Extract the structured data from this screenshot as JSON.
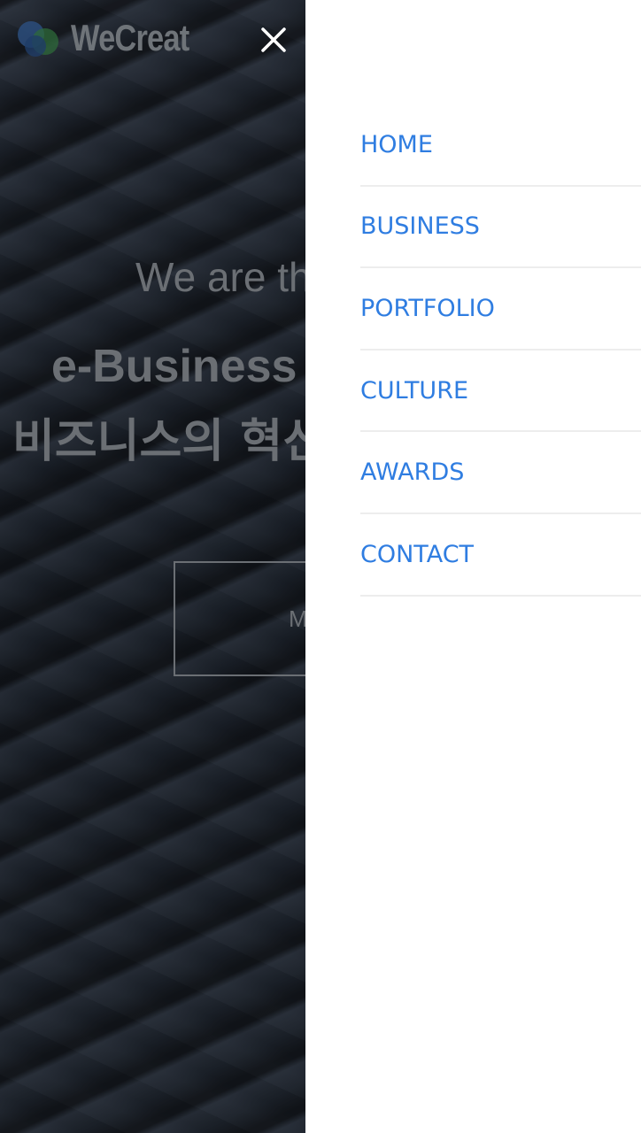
{
  "header": {
    "logo_text": "WeCreat",
    "close_icon": "close-icon"
  },
  "hero": {
    "line1": "We are th",
    "line2": "e-Business",
    "line3": "비즈니스의 혁신",
    "button_label": "M"
  },
  "drawer": {
    "items": [
      {
        "label": "HOME"
      },
      {
        "label": "BUSINESS"
      },
      {
        "label": "PORTFOLIO"
      },
      {
        "label": "CULTURE"
      },
      {
        "label": "AWARDS"
      },
      {
        "label": "CONTACT"
      }
    ]
  },
  "colors": {
    "accent": "#2f7de1",
    "divider": "#ededed",
    "drawer_bg": "#ffffff",
    "overlay_text": "#6b6f74"
  }
}
